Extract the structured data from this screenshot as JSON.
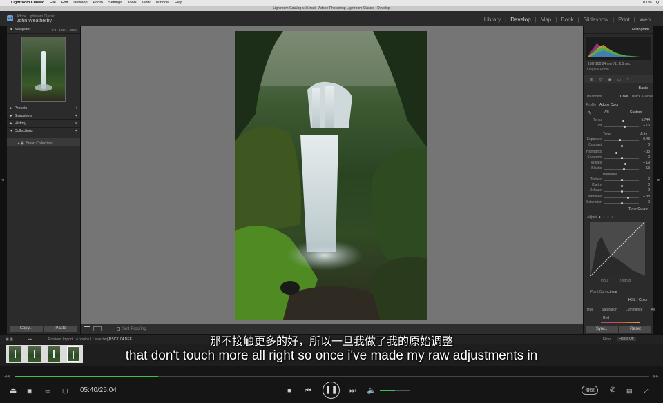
{
  "mac_menu": {
    "apple": "",
    "app": "Lightroom Classic",
    "items": [
      "File",
      "Edit",
      "Develop",
      "Photo",
      "Settings",
      "Tools",
      "View",
      "Window",
      "Help"
    ],
    "right": [
      "100%",
      "Q"
    ]
  },
  "title_bar": "Lightroom Catalog-v10.lrcat - Adobe Photoshop Lightroom Classic - Develop",
  "identity": {
    "line1": "Adobe Lightroom Classic",
    "line2": "John Weatherby"
  },
  "logo": "Lrc",
  "modules": [
    "Library",
    "Develop",
    "Map",
    "Book",
    "Slideshow",
    "Print",
    "Web"
  ],
  "left_panel": {
    "navigator": {
      "label": "Navigator",
      "fit": "Fit",
      "zoom1": "100%",
      "zoom2": "400%"
    },
    "sections": [
      "Presets",
      "Snapshots",
      "History",
      "Collections"
    ],
    "smart_collections": "Smart Collections",
    "copy": "Copy...",
    "paste": "Paste"
  },
  "right_panel": {
    "histogram": "Histogram",
    "histo_values": "ISO 100   24mm   f/11   2.5 sec",
    "original_photo": "Original Photo",
    "basic": "Basic",
    "treatment": "Treatment",
    "color": "Color",
    "bw": "Black & White",
    "profile": "Profile",
    "profile_value": "Adobe Color",
    "wb": "WB",
    "wb_value": "Custom",
    "tone": "Tone",
    "auto": "Auto",
    "presence": "Presence",
    "sliders1": [
      {
        "label": "Temp",
        "value": "5,744",
        "pos": 0.55
      },
      {
        "label": "Tint",
        "value": "+ 16",
        "pos": 0.58
      }
    ],
    "sliders2": [
      {
        "label": "Exposure",
        "value": "- 0.48",
        "pos": 0.45
      },
      {
        "label": "Contrast",
        "value": "0",
        "pos": 0.5
      }
    ],
    "sliders3": [
      {
        "label": "Highlights",
        "value": "- 33",
        "pos": 0.35
      },
      {
        "label": "Shadows",
        "value": "0",
        "pos": 0.5
      },
      {
        "label": "Whites",
        "value": "+ 19",
        "pos": 0.6
      },
      {
        "label": "Blacks",
        "value": "+ 13",
        "pos": 0.57
      }
    ],
    "sliders4": [
      {
        "label": "Texture",
        "value": "0",
        "pos": 0.5
      },
      {
        "label": "Clarity",
        "value": "0",
        "pos": 0.5
      },
      {
        "label": "Dehaze",
        "value": "0",
        "pos": 0.5
      }
    ],
    "sliders5": [
      {
        "label": "Vibrance",
        "value": "+ 38",
        "pos": 0.68
      },
      {
        "label": "Saturation",
        "value": "0",
        "pos": 0.5
      }
    ],
    "tone_curve": "Tone Curve",
    "adjust": "Adjust",
    "curve_left": "Input",
    "curve_right": "Output",
    "point_curve": "Point Curve",
    "point_curve_value": "Linear",
    "hsl": "HSL / Color",
    "hsl_tabs": [
      "Hue",
      "Saturation",
      "Luminance",
      "All"
    ],
    "hsl_row": "Red",
    "sync": "Sync...",
    "reset": "Reset"
  },
  "center_toolbar": {
    "soft_proofing": "Soft Proofing"
  },
  "filmstrip_bar": {
    "source": "Previous Import",
    "info": "4 photos / 1 selected /",
    "file": "_DSC3104.NEF",
    "filter": "Filter",
    "filter_value": "Filters Off"
  },
  "subtitles": {
    "chinese": "那不接触更多的好，所以一旦我做了我的原始调整",
    "english": "that don't touch more all right so once i've made my raw adjustments in"
  },
  "player": {
    "time": "05:40/25:04",
    "progress": 0.226,
    "speed": "倍速",
    "volume": 0.5
  }
}
